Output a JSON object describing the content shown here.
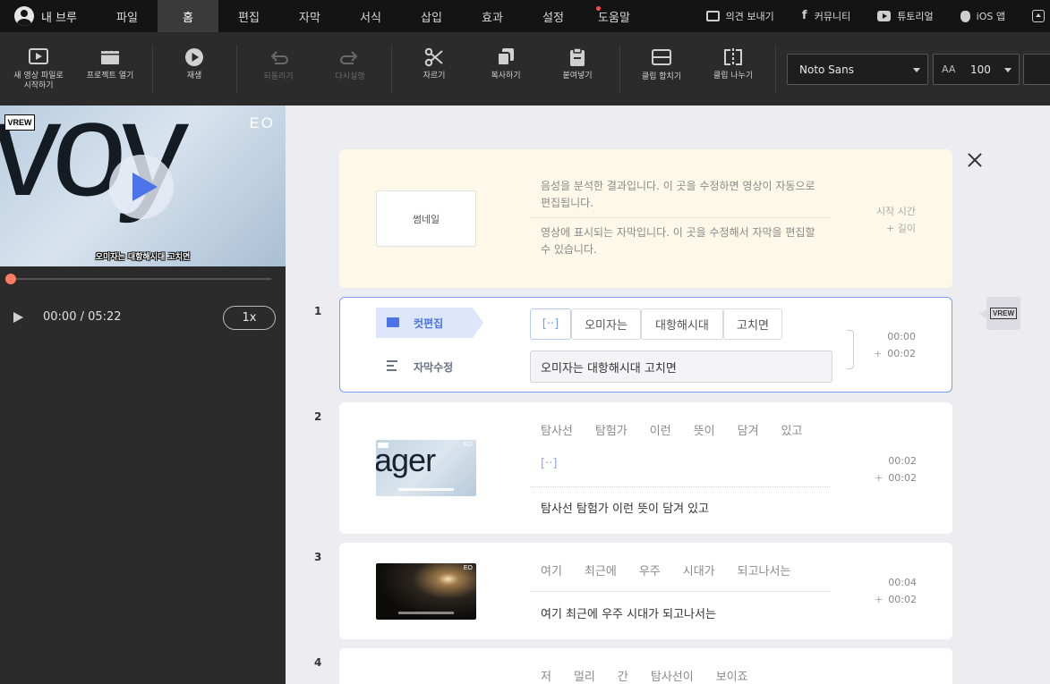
{
  "menubar": {
    "profile": "내 브루",
    "tabs": [
      "파일",
      "홈",
      "편집",
      "자막",
      "서식",
      "삽입",
      "효과",
      "설정",
      "도움말"
    ],
    "active_tab": "홈",
    "feedback": "의견 보내기",
    "community": "커뮤니티",
    "tutorial": "튜토리얼",
    "ios": "iOS 앱"
  },
  "toolbar": {
    "new_video": [
      "새 영상 파일로",
      "시작하기"
    ],
    "open_project": "프로젝트 열기",
    "play": "재생",
    "undo": "되돌리기",
    "redo": "다시실행",
    "cut": "자르기",
    "copy": "복사하기",
    "paste": "붙여넣기",
    "merge_clip": "클립 합치기",
    "split_clip": "클립 나누기",
    "font": "Noto Sans",
    "font_size": "100",
    "font_size_icon": "AA"
  },
  "preview": {
    "big_text": "voy",
    "logo_vrew": "VREW",
    "logo_eo": "EO",
    "subtitle": "오미자는 대항해시대 고치면",
    "timecode": "00:00 / 05:22",
    "speed": "1x",
    "progress": 0
  },
  "info_card": {
    "thumbnail_label": "썸네일",
    "text_audio": "음성을 분석한 결과입니다. 이 곳을 수정하면 영상이 자동으로 편집됩니다.",
    "text_subtitle": "영상에 표시되는 자막입니다. 이 곳을 수정해서 자막을 편집할 수 있습니다.",
    "start_time_label": "시작 시간",
    "length_label": "+ 길이"
  },
  "rows": [
    {
      "num": "1",
      "mode_cut": "컷편집",
      "mode_sub": "자막수정",
      "words": [
        "[··]",
        "오미자는",
        "대항해시대",
        "고치면"
      ],
      "subtitle": "오미자는 대항해시대 고치면",
      "start": "00:00",
      "length": "00:02"
    },
    {
      "num": "2",
      "words": [
        "탐사선",
        "탐험가",
        "이런",
        "뜻이",
        "담겨",
        "있고"
      ],
      "gap": "[··]",
      "subtitle": "탐사선 탐험가 이런 뜻이 담겨 있고",
      "thumb_text": "ager",
      "start": "00:02",
      "length": "00:02"
    },
    {
      "num": "3",
      "words": [
        "여기",
        "최근에",
        "우주",
        "시대가",
        "되고나서는"
      ],
      "subtitle": "여기 최근에 우주 시대가 되고나서는",
      "start": "00:04",
      "length": "00:02"
    },
    {
      "num": "4",
      "words": [
        "저",
        "멀리",
        "간",
        "탐사선이",
        "보이죠"
      ]
    }
  ],
  "plus": "+",
  "side_logo": "VREW",
  "mini_eo": "EO"
}
